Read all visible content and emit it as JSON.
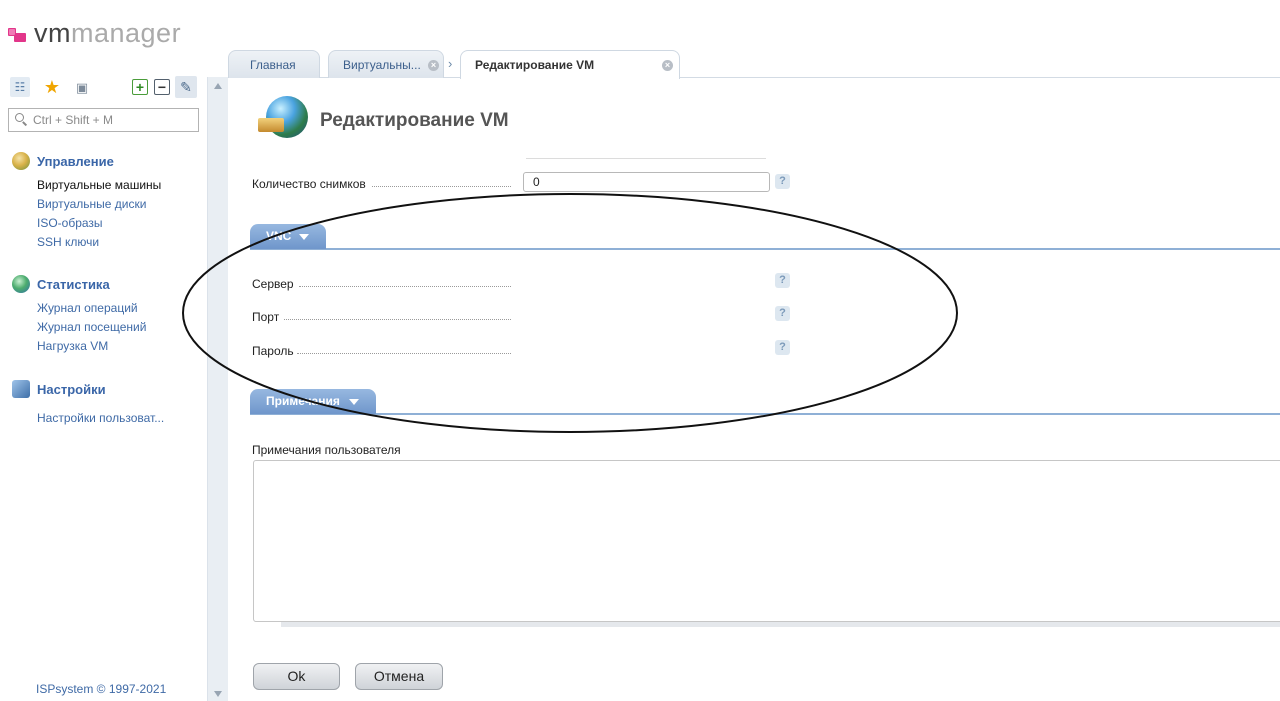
{
  "app": {
    "logo_vm": "vm",
    "logo_manager": "manager"
  },
  "sidebar": {
    "search_placeholder": "Ctrl + Shift + M",
    "groups": [
      {
        "title": "Управление",
        "icon": "management-icon",
        "items": [
          {
            "label": "Виртуальные машины",
            "active": true
          },
          {
            "label": "Виртуальные диски"
          },
          {
            "label": "ISO-образы"
          },
          {
            "label": "SSH ключи"
          }
        ]
      },
      {
        "title": "Статистика",
        "icon": "statistics-icon",
        "items": [
          {
            "label": "Журнал операций"
          },
          {
            "label": "Журнал посещений"
          },
          {
            "label": "Нагрузка VM"
          }
        ]
      },
      {
        "title": "Настройки",
        "icon": "settings-icon",
        "items": [
          {
            "label": "Настройки пользоват..."
          }
        ]
      }
    ],
    "copyright": "ISPsystem © 1997-2021"
  },
  "tabs": [
    {
      "label": "Главная"
    },
    {
      "label": "Виртуальны..."
    },
    {
      "label": "Редактирование VM",
      "active": true
    }
  ],
  "page": {
    "title": "Редактирование VM"
  },
  "form": {
    "snapshots_label": "Количество снимков",
    "snapshots_value": "0",
    "vnc_section": "VNC",
    "server_label": "Сервер",
    "port_label": "Порт",
    "password_label": "Пароль",
    "notes_section": "Примечания",
    "user_notes_label": "Примечания пользователя",
    "user_notes_value": "",
    "help_glyph": "?"
  },
  "buttons": {
    "ok": "Ok",
    "cancel": "Отмена"
  },
  "colors": {
    "accent": "#3f6aa6",
    "section_tab": "#7fa3d4",
    "logo_mark": "#e2368a"
  }
}
